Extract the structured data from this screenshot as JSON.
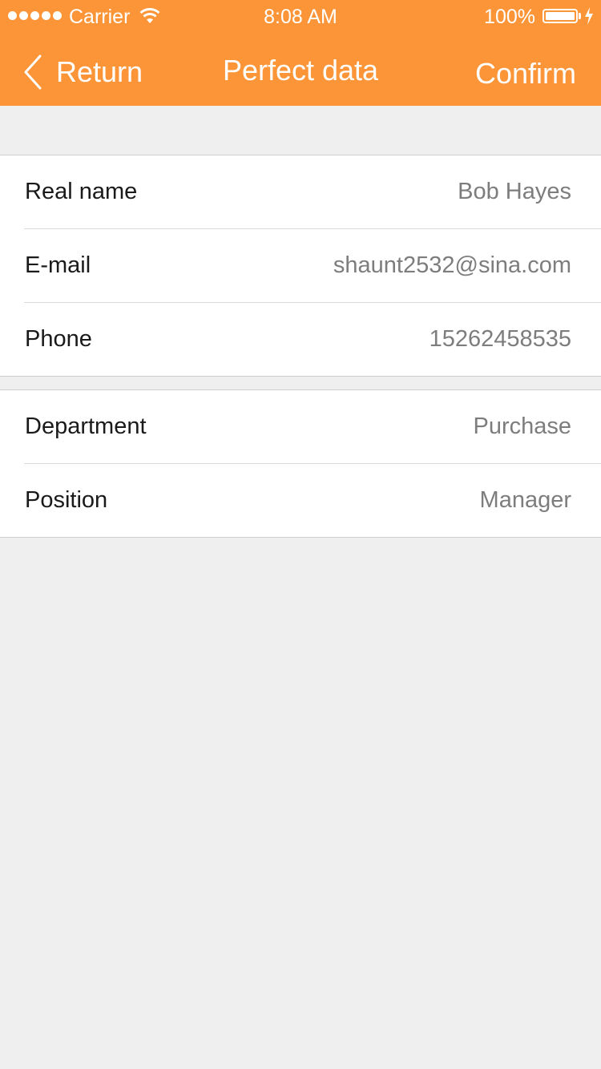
{
  "status_bar": {
    "carrier": "Carrier",
    "time": "8:08 AM",
    "battery": "100%",
    "icons": [
      "signal-dots",
      "wifi-icon",
      "battery-icon",
      "charging-bolt-icon"
    ]
  },
  "nav": {
    "back_label": "Return",
    "title": "Perfect data",
    "confirm_label": "Confirm",
    "background": "#fb9538"
  },
  "groups": [
    {
      "rows": [
        {
          "label": "Real name",
          "value": "Bob Hayes"
        },
        {
          "label": "E-mail",
          "value": "shaunt2532@sina.com"
        },
        {
          "label": "Phone",
          "value": "15262458535"
        }
      ]
    },
    {
      "rows": [
        {
          "label": "Department",
          "value": "Purchase"
        },
        {
          "label": "Position",
          "value": "Manager"
        }
      ]
    }
  ]
}
